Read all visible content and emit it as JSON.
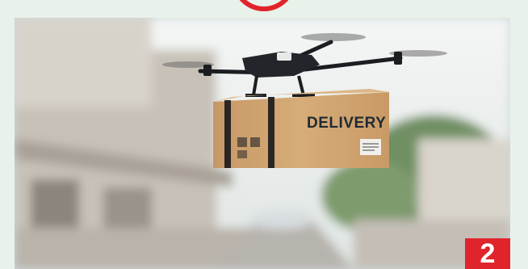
{
  "image": {
    "description_icon": "photo",
    "box_label": "DELIVERY",
    "step_number": "2",
    "accent_color": "#e0242b",
    "page_background": "#e9f2ea"
  }
}
